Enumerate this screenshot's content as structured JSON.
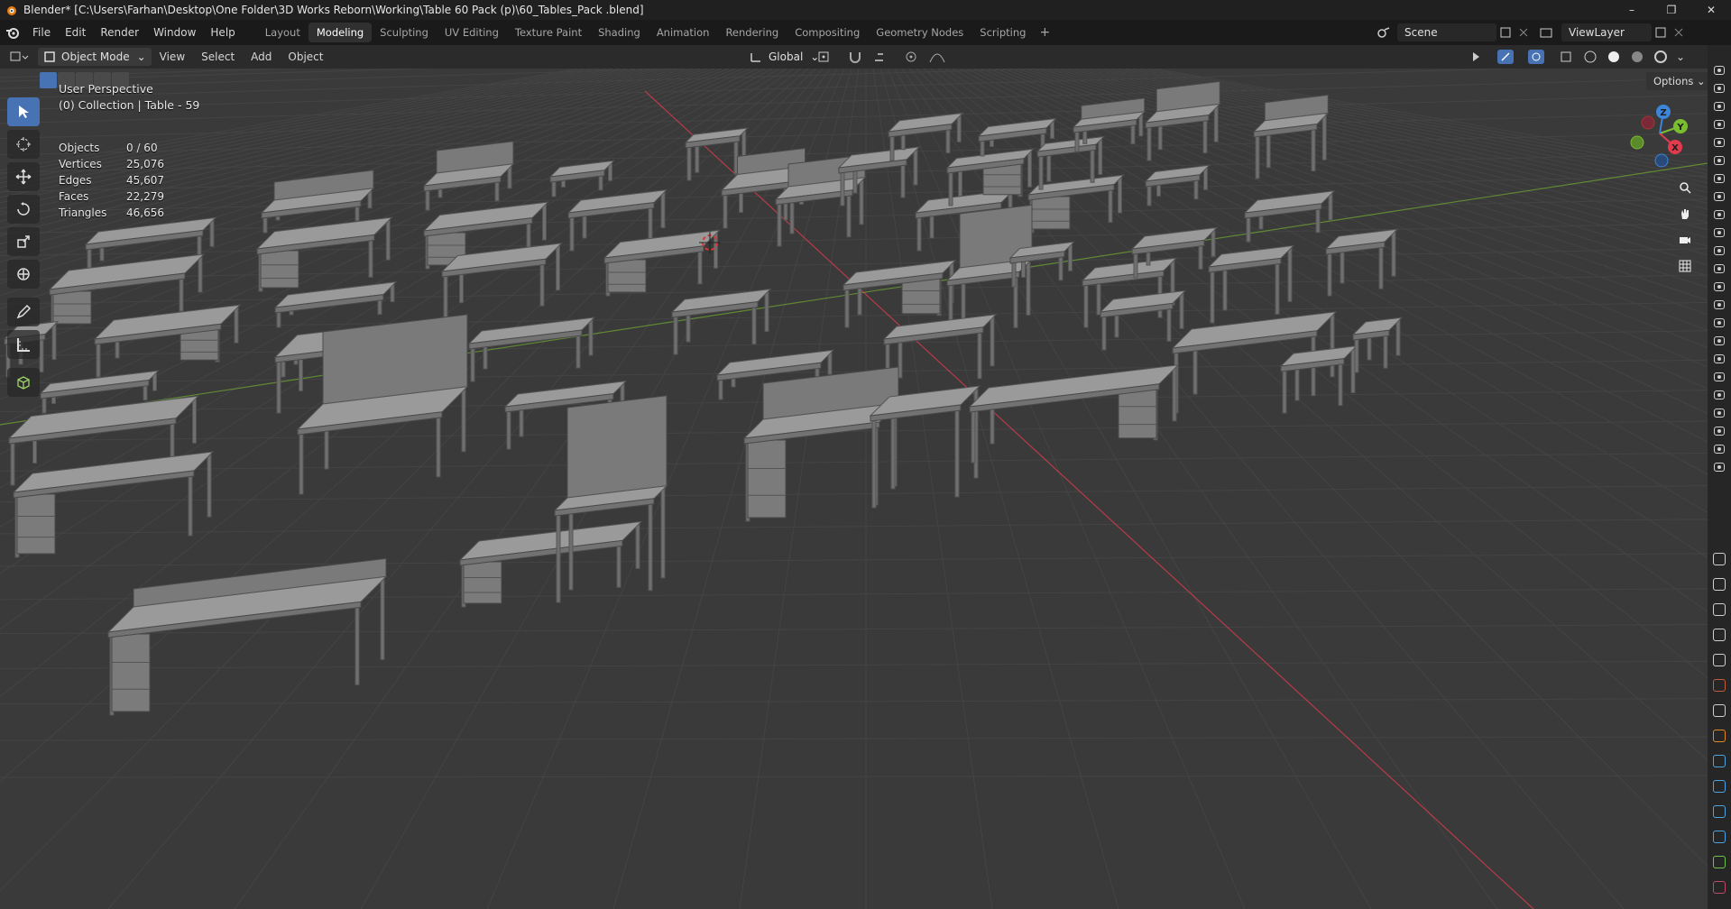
{
  "window": {
    "title": "Blender* [C:\\Users\\Farhan\\Desktop\\One Folder\\3D Works Reborn\\Working\\Table 60 Pack (p)\\60_Tables_Pack .blend]",
    "controls": [
      "–",
      "❐",
      "✕"
    ]
  },
  "menu": [
    "File",
    "Edit",
    "Render",
    "Window",
    "Help"
  ],
  "workspaces": {
    "tabs": [
      "Layout",
      "Modeling",
      "Sculpting",
      "UV Editing",
      "Texture Paint",
      "Shading",
      "Animation",
      "Rendering",
      "Compositing",
      "Geometry Nodes",
      "Scripting"
    ],
    "active": "Modeling",
    "add": "+"
  },
  "scene": {
    "name": "Scene",
    "view_layer": "ViewLayer"
  },
  "viewport_header": {
    "mode": "Object Mode",
    "items": [
      "View",
      "Select",
      "Add",
      "Object"
    ],
    "transform_orientation": "Global",
    "options": "Options"
  },
  "overlay": {
    "view_name": "User Perspective",
    "collection": "(0) Collection | Table - 59"
  },
  "stats": [
    {
      "label": "Objects",
      "value": "0 / 60"
    },
    {
      "label": "Vertices",
      "value": "25,076"
    },
    {
      "label": "Edges",
      "value": "45,607"
    },
    {
      "label": "Faces",
      "value": "22,279"
    },
    {
      "label": "Triangles",
      "value": "46,656"
    }
  ],
  "gizmo": {
    "x": "X",
    "y": "Y",
    "z": "Z"
  },
  "colors": {
    "accent": "#4772b3",
    "x_axis": "#e23b4e",
    "y_axis": "#7bbd31",
    "z_axis": "#3d85d9",
    "grid": "#444444",
    "background": "#3a3a3a",
    "mesh": "#8a8a8a"
  }
}
